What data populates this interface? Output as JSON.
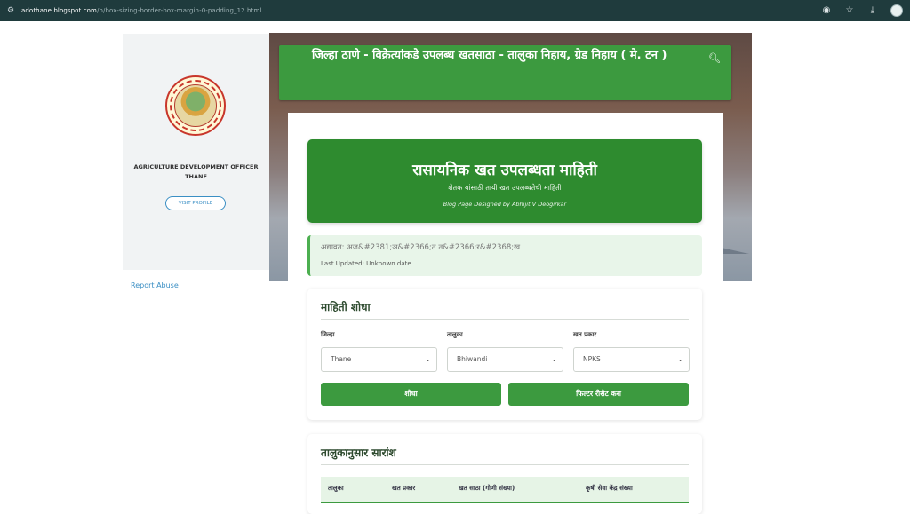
{
  "browser": {
    "url_domain": "adothane.blogspot.com",
    "url_path": "/p/box-sizing-border-box-margin-0-padding_12.html"
  },
  "sidebar": {
    "profile_name_line1": "AGRICULTURE DEVELOPMENT OFFICER",
    "profile_name_line2": "THANE",
    "visit_profile": "VISIT PROFILE",
    "report_abuse": "Report Abuse"
  },
  "header": {
    "title": "जिल्हा ठाणे - विक्रेत्यांकडे उपलब्ध खतसाठा - तालुका निहाय, ग्रेड निहाय ( मे. टन )"
  },
  "hero": {
    "title": "रासायनिक खत उपलब्धता माहिती",
    "subtitle": "शेतक यांसाठी तायी खत उपलब्धतेची माहिती",
    "credit": "Blog Page Designed by Abhijit V Deogirkar"
  },
  "update": {
    "line1": "अद्यावत: अज&#2381;ञ&#2366;त त&#2366;र&#2368;ख",
    "line2": "Last Updated: Unknown date"
  },
  "search": {
    "title": "माहिती शोधा",
    "district_label": "जिल्हा",
    "district_value": "Thane",
    "taluka_label": "तालुका",
    "taluka_value": "Bhiwandi",
    "fert_label": "खत प्रकार",
    "fert_value": "NPKS",
    "search_button": "शोधा",
    "reset_button": "फिल्टर रीसेट करा"
  },
  "summary": {
    "title": "तालुकानुसार सारांश",
    "columns": [
      "तालुका",
      "खत प्रकार",
      "खत साठा (गोणी संख्या)",
      "कृषी सेवा केंद्र संख्या"
    ]
  }
}
